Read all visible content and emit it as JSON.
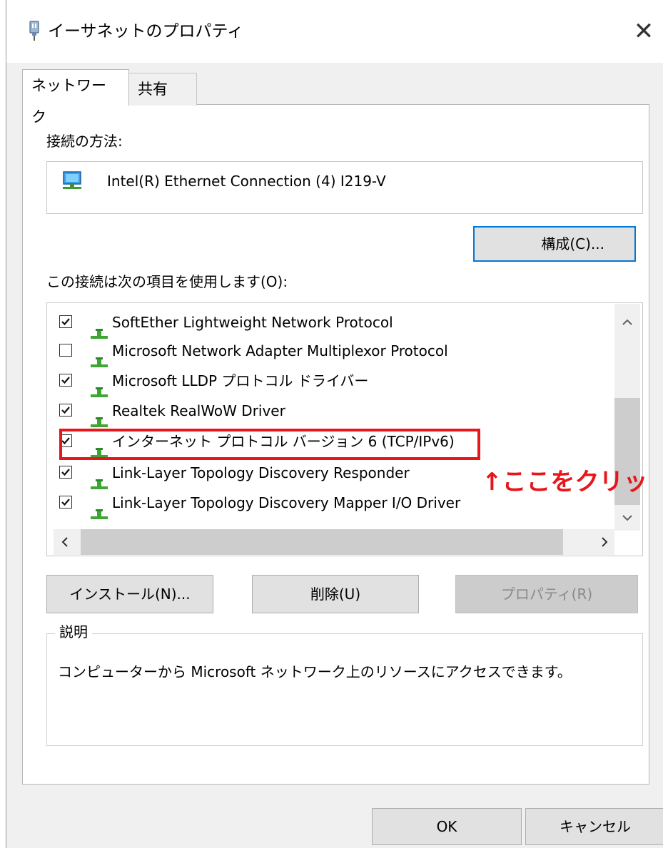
{
  "window": {
    "title": "イーサネットのプロパティ",
    "close_glyph": "✕",
    "icon": "network-cable-icon"
  },
  "tabs": [
    {
      "label": "ネットワーク",
      "selected": true
    },
    {
      "label": "共有",
      "selected": false
    }
  ],
  "connection": {
    "label": "接続の方法:",
    "adapter_name": "Intel(R) Ethernet Connection (4) I219-V",
    "adapter_icon": "network-adapter-icon",
    "configure_button": "構成(C)..."
  },
  "items_section": {
    "label": "この接続は次の項目を使用します(O):",
    "items": [
      {
        "label": "SoftEther Lightweight Network Protocol",
        "checked": true
      },
      {
        "label": "Microsoft Network Adapter Multiplexor Protocol",
        "checked": false
      },
      {
        "label": "Microsoft LLDP プロトコル ドライバー",
        "checked": true
      },
      {
        "label": "Realtek RealWoW Driver",
        "checked": true
      },
      {
        "label": "インターネット プロトコル バージョン 6 (TCP/IPv6)",
        "checked": true
      },
      {
        "label": "Link-Layer Topology Discovery Responder",
        "checked": true
      },
      {
        "label": "Link-Layer Topology Discovery Mapper I/O Driver",
        "checked": true
      }
    ],
    "scroll_up": "^",
    "scroll_down": "v",
    "scroll_left": "<",
    "scroll_right": ">"
  },
  "annotation": {
    "text": "↑ここをクリッ",
    "color": "#e8161b"
  },
  "action_buttons": {
    "install": "インストール(N)...",
    "remove": "削除(U)",
    "properties": "プロパティ(R)"
  },
  "description": {
    "group_label": "説明",
    "text": "コンピューターから Microsoft ネットワーク上のリソースにアクセスできます。"
  },
  "footer": {
    "ok": "OK",
    "cancel": "キャンセル"
  },
  "colors": {
    "accent": "#0078d7",
    "highlight": "#e8161b",
    "dialog_bg": "#f0f0f0"
  }
}
